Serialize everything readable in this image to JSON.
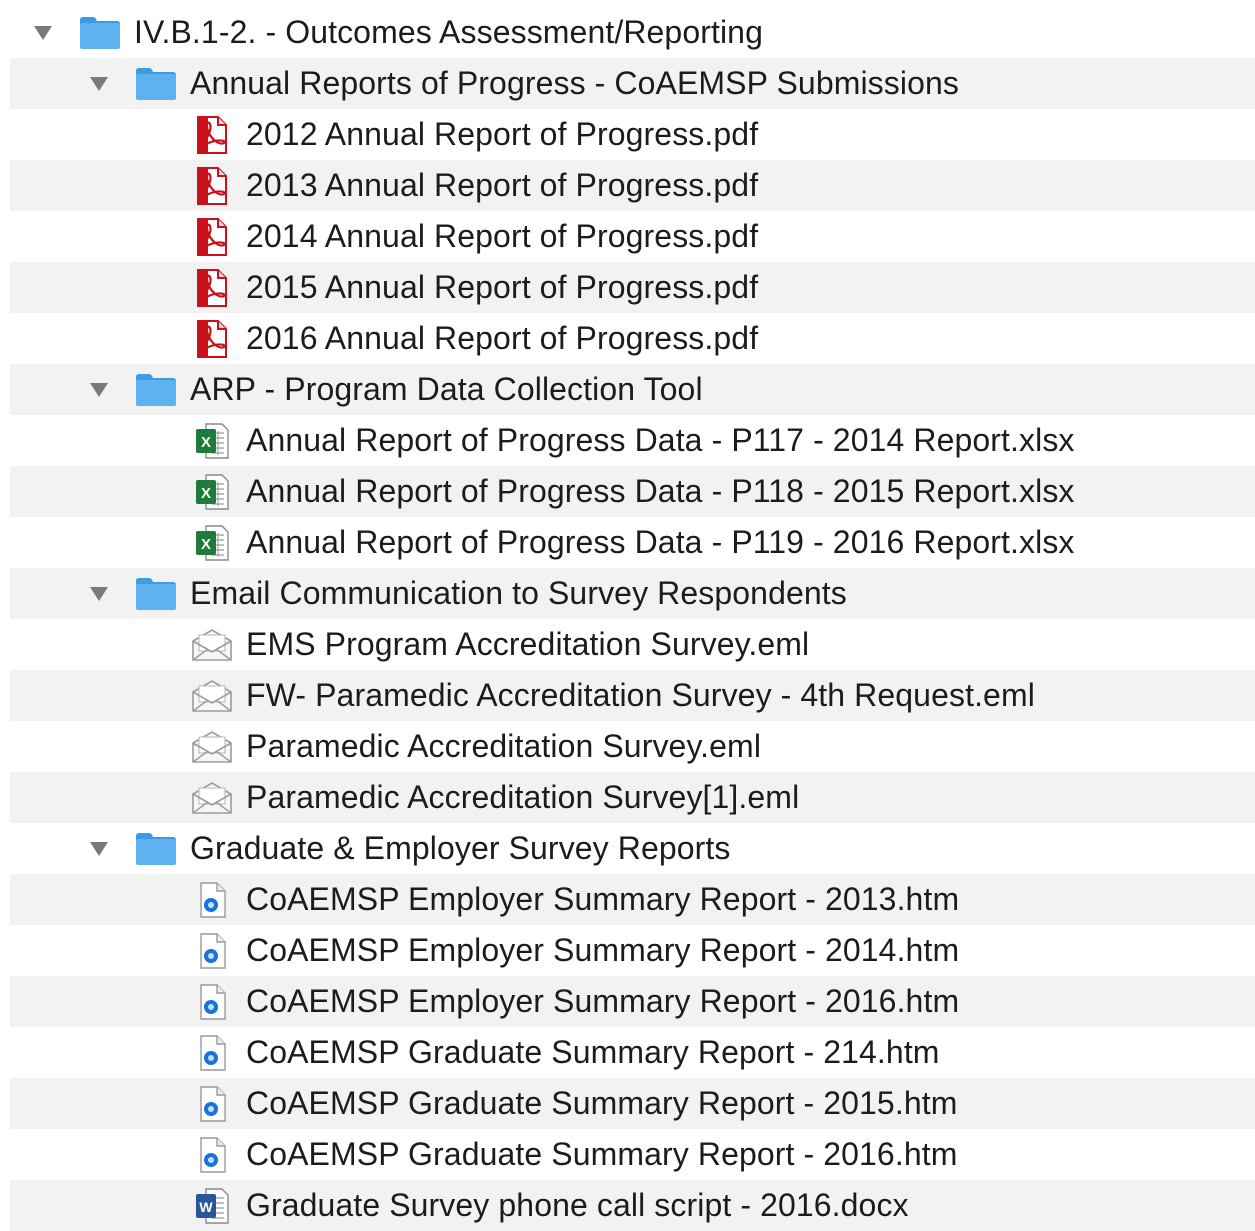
{
  "colors": {
    "folder": "#5db2ef",
    "folder_dark": "#3c9be3",
    "pdf": "#c8111a",
    "excel": "#1f7b3c",
    "word": "#2b579a",
    "htm": "#1a73d9",
    "stripe": "#f2f2f2",
    "text": "#1c1c1c"
  },
  "tree": {
    "root": {
      "name": "IV.B.1-2. - Outcomes Assessment/Reporting",
      "icon": "folder-icon",
      "expanded": true
    },
    "folders": [
      {
        "name": "Annual Reports of Progress - CoAEMSP Submissions",
        "icon": "folder-icon",
        "expanded": true,
        "files": [
          {
            "name": "2012 Annual Report of Progress.pdf",
            "icon": "pdf-icon"
          },
          {
            "name": "2013 Annual Report of Progress.pdf",
            "icon": "pdf-icon"
          },
          {
            "name": "2014 Annual Report of Progress.pdf",
            "icon": "pdf-icon"
          },
          {
            "name": "2015 Annual Report of Progress.pdf",
            "icon": "pdf-icon"
          },
          {
            "name": "2016 Annual Report of Progress.pdf",
            "icon": "pdf-icon"
          }
        ]
      },
      {
        "name": "ARP - Program Data Collection Tool",
        "icon": "folder-icon",
        "expanded": true,
        "files": [
          {
            "name": "Annual Report of Progress Data - P117 - 2014 Report.xlsx",
            "icon": "excel-icon"
          },
          {
            "name": "Annual Report of Progress Data - P118 - 2015 Report.xlsx",
            "icon": "excel-icon"
          },
          {
            "name": "Annual Report of Progress Data - P119 - 2016 Report.xlsx",
            "icon": "excel-icon"
          }
        ]
      },
      {
        "name": "Email Communication to Survey Respondents",
        "icon": "folder-icon",
        "expanded": true,
        "files": [
          {
            "name": "EMS Program Accreditation Survey.eml",
            "icon": "email-icon"
          },
          {
            "name": "FW- Paramedic Accreditation Survey - 4th Request.eml",
            "icon": "email-icon"
          },
          {
            "name": "Paramedic Accreditation Survey.eml",
            "icon": "email-icon"
          },
          {
            "name": "Paramedic Accreditation Survey[1].eml",
            "icon": "email-icon"
          }
        ]
      },
      {
        "name": "Graduate & Employer Survey Reports",
        "icon": "folder-icon",
        "expanded": true,
        "files": [
          {
            "name": "CoAEMSP Employer Summary Report - 2013.htm",
            "icon": "htm-icon"
          },
          {
            "name": "CoAEMSP Employer Summary Report - 2014.htm",
            "icon": "htm-icon"
          },
          {
            "name": "CoAEMSP Employer Summary Report - 2016.htm",
            "icon": "htm-icon"
          },
          {
            "name": "CoAEMSP Graduate Summary Report - 214.htm",
            "icon": "htm-icon"
          },
          {
            "name": "CoAEMSP Graduate Summary Report - 2015.htm",
            "icon": "htm-icon"
          },
          {
            "name": "CoAEMSP Graduate Summary Report - 2016.htm",
            "icon": "htm-icon"
          },
          {
            "name": "Graduate Survey phone call script - 2016.docx",
            "icon": "word-icon"
          }
        ]
      }
    ]
  }
}
